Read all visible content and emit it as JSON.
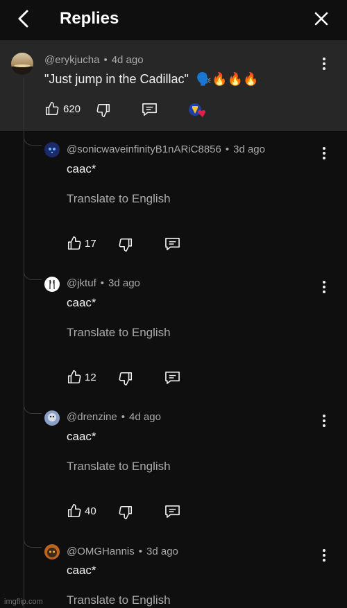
{
  "header": {
    "title": "Replies"
  },
  "parent_comment": {
    "handle": "@erykjucha",
    "age": "4d ago",
    "text": "\"Just jump in the Cadillac\"",
    "emojis": "🗣️🔥🔥🔥",
    "likes": "620"
  },
  "replies": [
    {
      "handle": "@sonicwaveinfinityB1nARiC8856",
      "age": "3d ago",
      "text": "caac*",
      "translate": "Translate to English",
      "likes": "17",
      "avatar_color": "#1b2a6b"
    },
    {
      "handle": "@jktuf",
      "age": "3d ago",
      "text": "caac*",
      "translate": "Translate to English",
      "likes": "12",
      "avatar_color": "#ffffff"
    },
    {
      "handle": "@drenzine",
      "age": "4d ago",
      "text": "caac*",
      "translate": "Translate to English",
      "likes": "40",
      "avatar_color": "#8aa0c8"
    },
    {
      "handle": "@OMGHannis",
      "age": "3d ago",
      "text": "caac*",
      "translate": "Translate to English",
      "avatar_color": "#c0641c"
    }
  ],
  "watermark": "imgflip.com",
  "colors": {
    "background": "#0f0f0f",
    "parent_background": "#272727",
    "secondary_text": "#aaaaaa",
    "heart": "#e02047"
  }
}
